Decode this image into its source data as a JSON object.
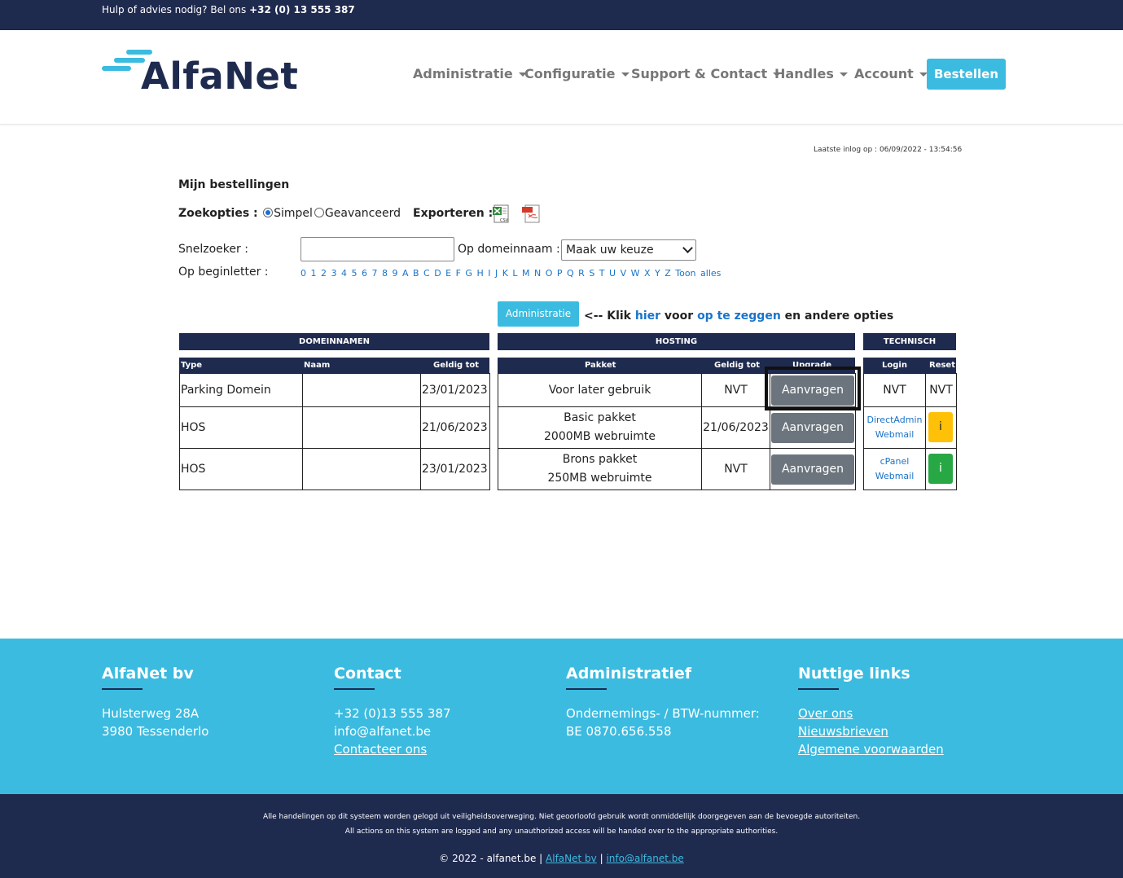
{
  "topbar": {
    "help_text": "Hulp of advies nodig? Bel ons",
    "phone": "+32 (0) 13 555 387"
  },
  "logo": {
    "text": "AlfaNet"
  },
  "nav": {
    "items": [
      {
        "label": "Administratie"
      },
      {
        "label": "Configuratie"
      },
      {
        "label": "Support & Contact"
      },
      {
        "label": "Handles"
      },
      {
        "label": "Account"
      }
    ],
    "order_button": "Bestellen"
  },
  "last_login": "Laatste inlog op : 06/09/2022 - 13:54:56",
  "page_title": "Mijn bestellingen",
  "search": {
    "options_label": "Zoekopties :",
    "simple_label": "Simpel",
    "advanced_label": "Geavanceerd",
    "export_label": "Exporteren :",
    "quick_label": "Snelzoeker :",
    "quick_value": "",
    "domain_label": "Op domeinnaam :",
    "domain_select": "Maak uw keuze",
    "letter_label": "Op beginletter :",
    "letters": "0 1 2 3 4 5 6 7 8 9 A B C D E F G H I J K L M N O P Q R S T U V W X Y Z Toon alles"
  },
  "admin_button": "Administratie",
  "hint": {
    "prefix": "<-- Klik",
    "link1": "hier",
    "mid": "voor",
    "link2": "op te zeggen",
    "suffix": "en andere opties"
  },
  "table": {
    "sections": {
      "domains": "DOMEINNAMEN",
      "hosting": "HOSTING",
      "technical": "TECHNISCH"
    },
    "columns": {
      "type": "Type",
      "name": "Naam",
      "valid": "Geldig tot",
      "package": "Pakket",
      "valid2": "Geldig tot",
      "upgrade": "Upgrade",
      "login": "Login",
      "reset": "Reset"
    },
    "rows": [
      {
        "type": "Parking Domein",
        "name": "",
        "valid": "23/01/2023",
        "package1": "Voor later gebruik",
        "package2": "",
        "valid2": "NVT",
        "upgrade": "Aanvragen",
        "login1": "NVT",
        "login2": "",
        "reset": "NVT"
      },
      {
        "type": "HOS",
        "name": "",
        "valid": "21/06/2023",
        "package1": "Basic pakket",
        "package2": "2000MB webruimte",
        "valid2": "21/06/2023",
        "upgrade": "Aanvragen",
        "login1": "DirectAdmin",
        "login2": "Webmail",
        "reset": "i"
      },
      {
        "type": "HOS",
        "name": "",
        "valid": "23/01/2023",
        "package1": "Brons pakket",
        "package2": "250MB webruimte",
        "valid2": "NVT",
        "upgrade": "Aanvragen",
        "login1": "cPanel",
        "login2": "Webmail",
        "reset": "i"
      }
    ]
  },
  "footer": {
    "company": {
      "title": "AlfaNet bv",
      "line1": "Hulsterweg 28A",
      "line2": "3980 Tessenderlo"
    },
    "contact": {
      "title": "Contact",
      "phone": "+32 (0)13 555 387",
      "email": "info@alfanet.be",
      "link": "Contacteer ons"
    },
    "admin": {
      "title": "Administratief",
      "line1": "Ondernemings- / BTW-nummer:",
      "line2": "BE 0870.656.558"
    },
    "links": {
      "title": "Nuttige links",
      "items": [
        "Over ons",
        "Nieuwsbrieven",
        "Algemene voorwaarden"
      ]
    }
  },
  "bottom": {
    "line1": "Alle handelingen op dit systeem worden gelogd uit veiligheidsoverweging. Niet geoorloofd gebruik wordt onmiddellijk doorgegeven aan de bevoegde autoriteiten.",
    "line2": "All actions on this system are logged and any unauthorized access will be handed over to the appropriate authorities.",
    "copyright": "© 2022 - alfanet.be |",
    "link1": "AlfaNet bv",
    "sep": "|",
    "link2": "info@alfanet.be"
  },
  "colors": {
    "navy": "#1f2a4f",
    "accent": "#3bbbe0",
    "button_grey": "#6c757d",
    "warning": "#ffc107",
    "success": "#28a745",
    "link": "#1a73c8"
  },
  "icons": [
    "csv-file-icon",
    "pdf-file-icon",
    "chevron-down-icon"
  ]
}
